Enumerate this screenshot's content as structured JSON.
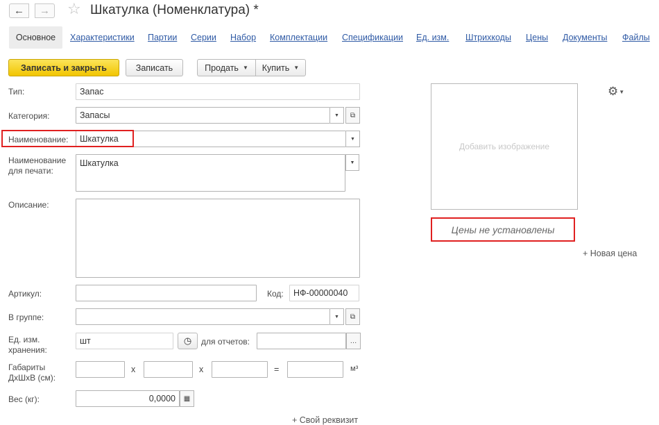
{
  "header": {
    "back_icon": "←",
    "forward_icon": "→",
    "star_icon": "☆",
    "title": "Шкатулка (Номенклатура) *"
  },
  "tabs": {
    "active": "Основное",
    "links": [
      "Характеристики",
      "Партии",
      "Серии",
      "Набор",
      "Комплектации",
      "Спецификации",
      "Ед. изм.",
      "Штрихкоды",
      "Цены",
      "Документы",
      "Файлы"
    ]
  },
  "toolbar": {
    "save_close": "Записать и закрыть",
    "save": "Записать",
    "sell": "Продать",
    "buy": "Купить"
  },
  "form": {
    "type_label": "Тип:",
    "type_value": "Запас",
    "category_label": "Категория:",
    "category_value": "Запасы",
    "name_label": "Наименование:",
    "name_value": "Шкатулка",
    "print_name_label_1": "Наименование",
    "print_name_label_2": "для печати:",
    "print_name_value": "Шкатулка",
    "description_label": "Описание:",
    "description_value": "",
    "article_label": "Артикул:",
    "article_value": "",
    "code_label": "Код:",
    "code_value": "НФ-00000040",
    "group_label": "В группе:",
    "group_value": "",
    "unit_label_1": "Ед. изм.",
    "unit_label_2": "хранения:",
    "unit_value": "шт",
    "report_label": "для отчетов:",
    "report_value": "",
    "dims_label_1": "Габариты",
    "dims_label_2": "ДхШхВ (см):",
    "dim_x": "х",
    "dim_eq": "=",
    "dim_unit": "м³",
    "weight_label": "Вес (кг):",
    "weight_value": "0,0000",
    "own_attr": "+ Свой реквизит"
  },
  "side": {
    "add_image": "Добавить изображение",
    "prices_status": "Цены не установлены",
    "new_price": "+ Новая цена",
    "gear_icon": "⚙"
  },
  "colors": {
    "highlight": "#e02020",
    "primary_button": "#f2c500",
    "link": "#2f5aa5"
  }
}
